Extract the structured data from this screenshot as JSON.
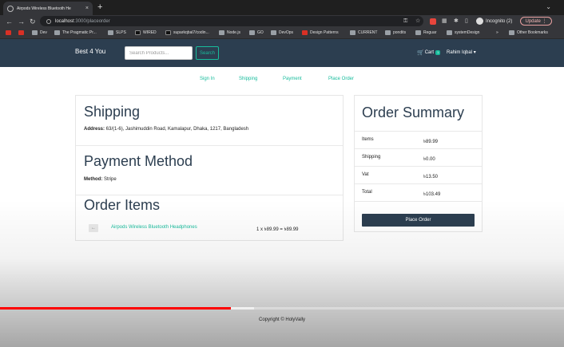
{
  "browser": {
    "tab_title": "Airpods Wireless Bluetooth He",
    "tab_close": "×",
    "new_tab": "+",
    "url_host": "localhost",
    "url_path": ":3000/placeorder",
    "incognito_label": "Incognito (2)",
    "update_label": "Update",
    "bookmarks": [
      {
        "label": "",
        "icon": "gmail-icon"
      },
      {
        "label": "",
        "icon": "youtube-icon"
      },
      {
        "label": "Dev",
        "icon": "folder-icon"
      },
      {
        "label": "The Pragmatic Pr...",
        "icon": "site-icon"
      },
      {
        "label": "SLPS",
        "icon": "folder-icon"
      },
      {
        "label": "WIRED",
        "icon": "site-icon"
      },
      {
        "label": "suparkqbal7/codin...",
        "icon": "github-icon"
      },
      {
        "label": "Node.js",
        "icon": "folder-icon"
      },
      {
        "label": "GO",
        "icon": "folder-icon"
      },
      {
        "label": "DevOps",
        "icon": "folder-icon"
      },
      {
        "label": "Design Patterns",
        "icon": "site-icon"
      },
      {
        "label": "CURRENT",
        "icon": "folder-icon"
      },
      {
        "label": "pondits",
        "icon": "folder-icon"
      },
      {
        "label": "Reguar",
        "icon": "folder-icon"
      },
      {
        "label": "systemDesign",
        "icon": "folder-icon"
      },
      {
        "label": "Other Bookmarks",
        "icon": "folder-icon"
      }
    ]
  },
  "navbar": {
    "brand": "Best 4 You",
    "search_placeholder": "Search Products...",
    "search_button": "Search",
    "cart_label": "Cart",
    "cart_count": "1",
    "user_name": "Rahim Iqbal",
    "user_caret": "▾"
  },
  "steps": [
    "Sign In",
    "Shipping",
    "Payment",
    "Place Order"
  ],
  "shipping": {
    "title": "Shipping",
    "address_label": "Address:",
    "address": " 63/(1-6), Jashimuddin Road, Kamalapur, Dhaka, 1217, Bangladesh"
  },
  "payment": {
    "title": "Payment Method",
    "method_label": "Method:",
    "method": " Stripe"
  },
  "order_items": {
    "title": "Order Items",
    "items": [
      {
        "name": "Airpods Wireless Bluetooth Headphones",
        "price_line": "1 x ৳89.99 = ৳89.99"
      }
    ]
  },
  "summary": {
    "title": "Order Summary",
    "rows": [
      {
        "label": "Items",
        "value": "৳89.99"
      },
      {
        "label": "Shipping",
        "value": "৳0.00"
      },
      {
        "label": "Vat",
        "value": "৳13.50"
      },
      {
        "label": "Total",
        "value": "৳103.49"
      }
    ],
    "button": "Place Order"
  },
  "footer": {
    "copyright": "Copyright © HolyVally"
  },
  "video": {
    "progress": 0.41,
    "buffered": 0.45
  },
  "colors": {
    "navbar": "#2c3e50",
    "accent": "#18bc9c",
    "progress": "#ff0000"
  }
}
